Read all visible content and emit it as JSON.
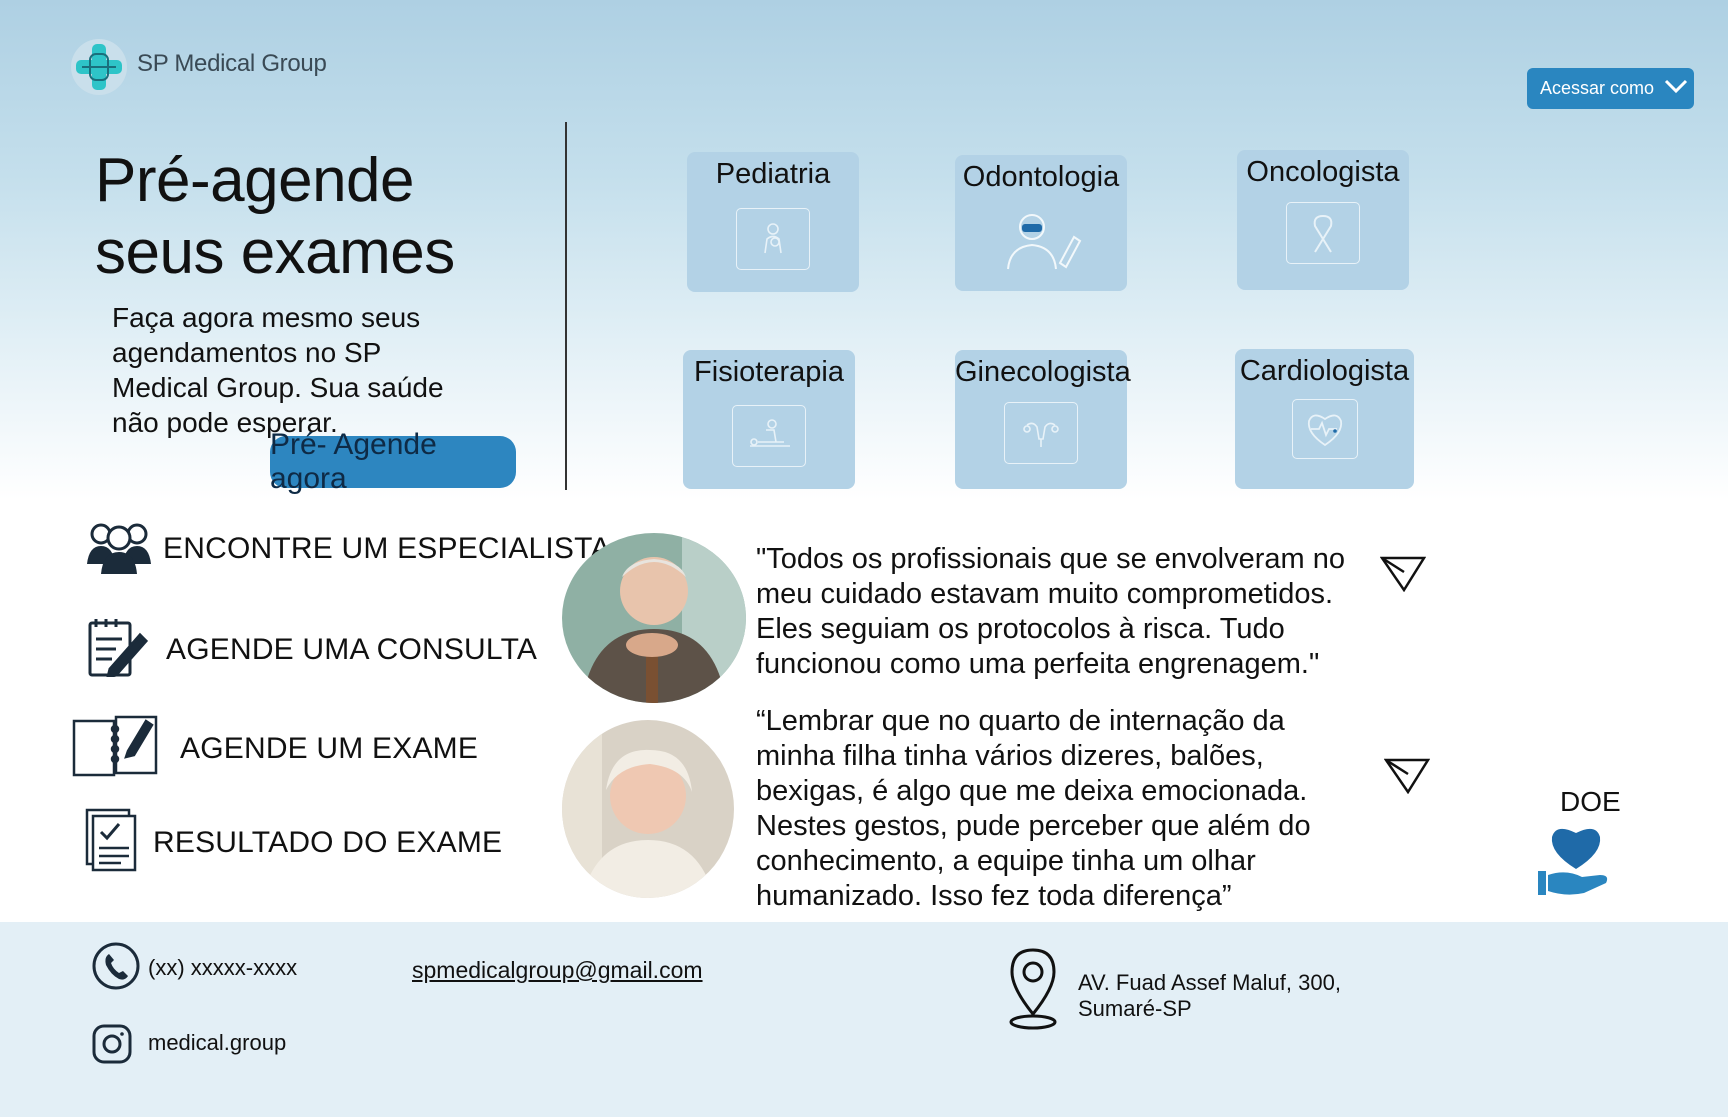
{
  "header": {
    "brand": "SP Medical Group",
    "access_button": "Acessar como"
  },
  "hero": {
    "title_line1": "Pré-agende",
    "title_line2": "seus exames",
    "subtitle": "Faça agora mesmo seus agendamentos no SP Medical Group. Sua saúde não pode esperar.",
    "cta": "Pré- Agende agora"
  },
  "specialties": [
    {
      "label": "Pediatria",
      "icon": "baby-care-icon"
    },
    {
      "label": "Odontologia",
      "icon": "dentist-icon"
    },
    {
      "label": "Oncologista",
      "icon": "ribbon-icon"
    },
    {
      "label": "Fisioterapia",
      "icon": "massage-icon"
    },
    {
      "label": "Ginecologista",
      "icon": "uterus-icon"
    },
    {
      "label": "Cardiologista",
      "icon": "heart-pulse-icon"
    }
  ],
  "menu": [
    {
      "label": "ENCONTRE UM ESPECIALISTA",
      "icon": "group-icon"
    },
    {
      "label": "AGENDE UMA CONSULTA",
      "icon": "notepad-pen-icon"
    },
    {
      "label": "AGENDE UM EXAME",
      "icon": "notebook-pen-icon"
    },
    {
      "label": "RESULTADO DO EXAME",
      "icon": "checklist-document-icon"
    }
  ],
  "testimonials": [
    {
      "text": "\"Todos os profissionais que se envolveram no meu cuidado estavam muito comprometidos. Eles seguiam os protocolos à risca. Tudo funcionou como uma perfeita engrenagem.\""
    },
    {
      "text": "“Lembrar que no quarto de internação da minha filha tinha vários dizeres, balões, bexigas, é algo que me deixa emocionada. Nestes gestos, pude perceber que além do conhecimento, a equipe tinha um olhar humanizado. Isso fez toda diferença”"
    }
  ],
  "donate": {
    "label": "DOE"
  },
  "footer": {
    "phone": "(xx) xxxxx-xxxx",
    "email": "spmedicalgroup@gmail.com",
    "instagram": "medical.group",
    "address_line1": "AV. Fuad Assef Maluf, 300,",
    "address_line2": "Sumaré-SP"
  },
  "colors": {
    "accent": "#2a86c0",
    "card": "#b3d2e6",
    "footer": "#e3eff6",
    "logo": "#2ec4c8",
    "heart": "#1f6aa8"
  }
}
